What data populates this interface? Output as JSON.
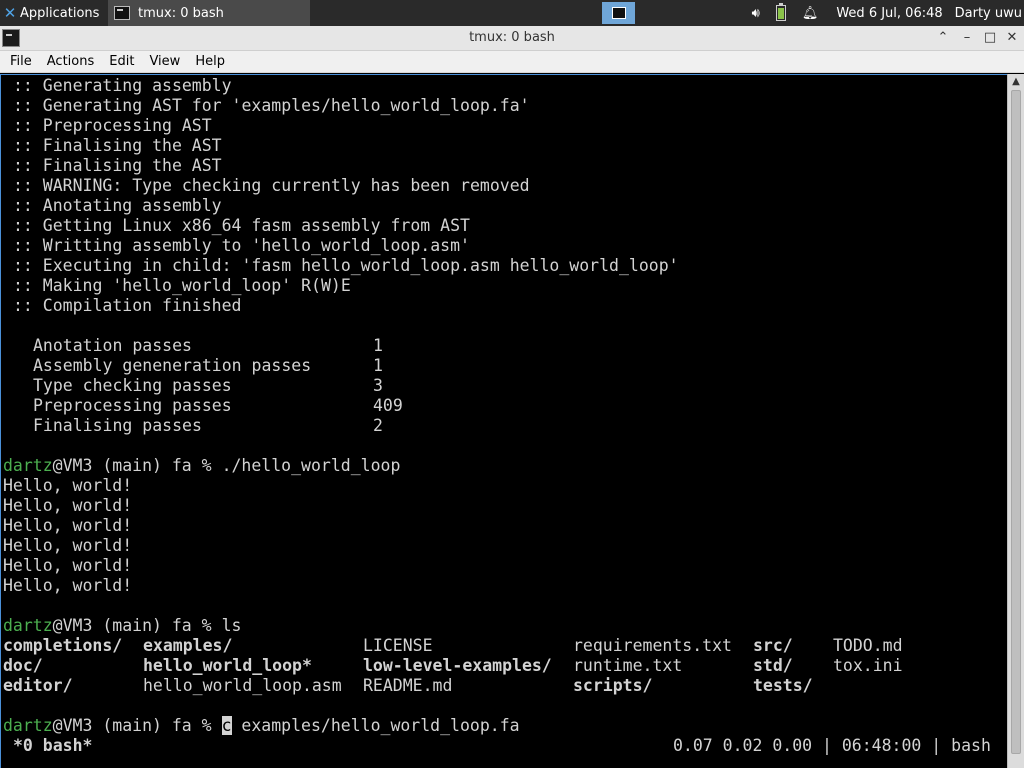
{
  "panel": {
    "apps_label": "Applications",
    "task_label": "tmux: 0 bash",
    "clock": "Wed  6 Jul, 06:48",
    "user": "Darty uwu"
  },
  "window": {
    "title": "tmux: 0 bash",
    "buttons": {
      "up": "⌃",
      "minimize": "–",
      "maximize": "□",
      "close": "✕"
    }
  },
  "menu": [
    "File",
    "Actions",
    "Edit",
    "View",
    "Help"
  ],
  "terminal": {
    "log": [
      ":: Generating assembly",
      ":: Generating AST for 'examples/hello_world_loop.fa'",
      ":: Preprocessing AST",
      ":: Finalising the AST",
      ":: Finalising the AST",
      ":: WARNING: Type checking currently has been removed",
      ":: Anotating assembly",
      ":: Getting Linux x86_64 fasm assembly from AST",
      ":: Writting assembly to 'hello_world_loop.asm'",
      ":: Executing in child: 'fasm hello_world_loop.asm hello_world_loop'",
      ":: Making 'hello_world_loop' R(W)E",
      ":: Compilation finished"
    ],
    "stats": [
      {
        "name": "Anotation passes",
        "value": "1"
      },
      {
        "name": "Assembly geneneration passes",
        "value": "1"
      },
      {
        "name": "Type checking passes",
        "value": "3"
      },
      {
        "name": "Preprocessing passes",
        "value": "409"
      },
      {
        "name": "Finalising passes",
        "value": "2"
      }
    ],
    "prompt_user": "dartz",
    "prompt_rest": "@VM3 (main) fa % ",
    "cmd1": "./hello_world_loop",
    "output": [
      "Hello, world!",
      "Hello, world!",
      "Hello, world!",
      "Hello, world!",
      "Hello, world!",
      "Hello, world!"
    ],
    "cmd2": "ls",
    "ls_rows": [
      [
        "completions/",
        "examples/",
        "LICENSE",
        "requirements.txt",
        "src/",
        "TODO.md"
      ],
      [
        "doc/",
        "hello_world_loop*",
        "low-level-examples/",
        "runtime.txt",
        "std/",
        "tox.ini"
      ],
      [
        "editor/",
        "hello_world_loop.asm",
        "README.md",
        "scripts/",
        "tests/",
        ""
      ]
    ],
    "cursor_char": "c",
    "cmd3_rest": " examples/hello_world_loop.fa"
  },
  "tmux": {
    "window": "*0 bash*",
    "status": "0.07 0.02 0.00 | 06:48:00 | bash"
  }
}
